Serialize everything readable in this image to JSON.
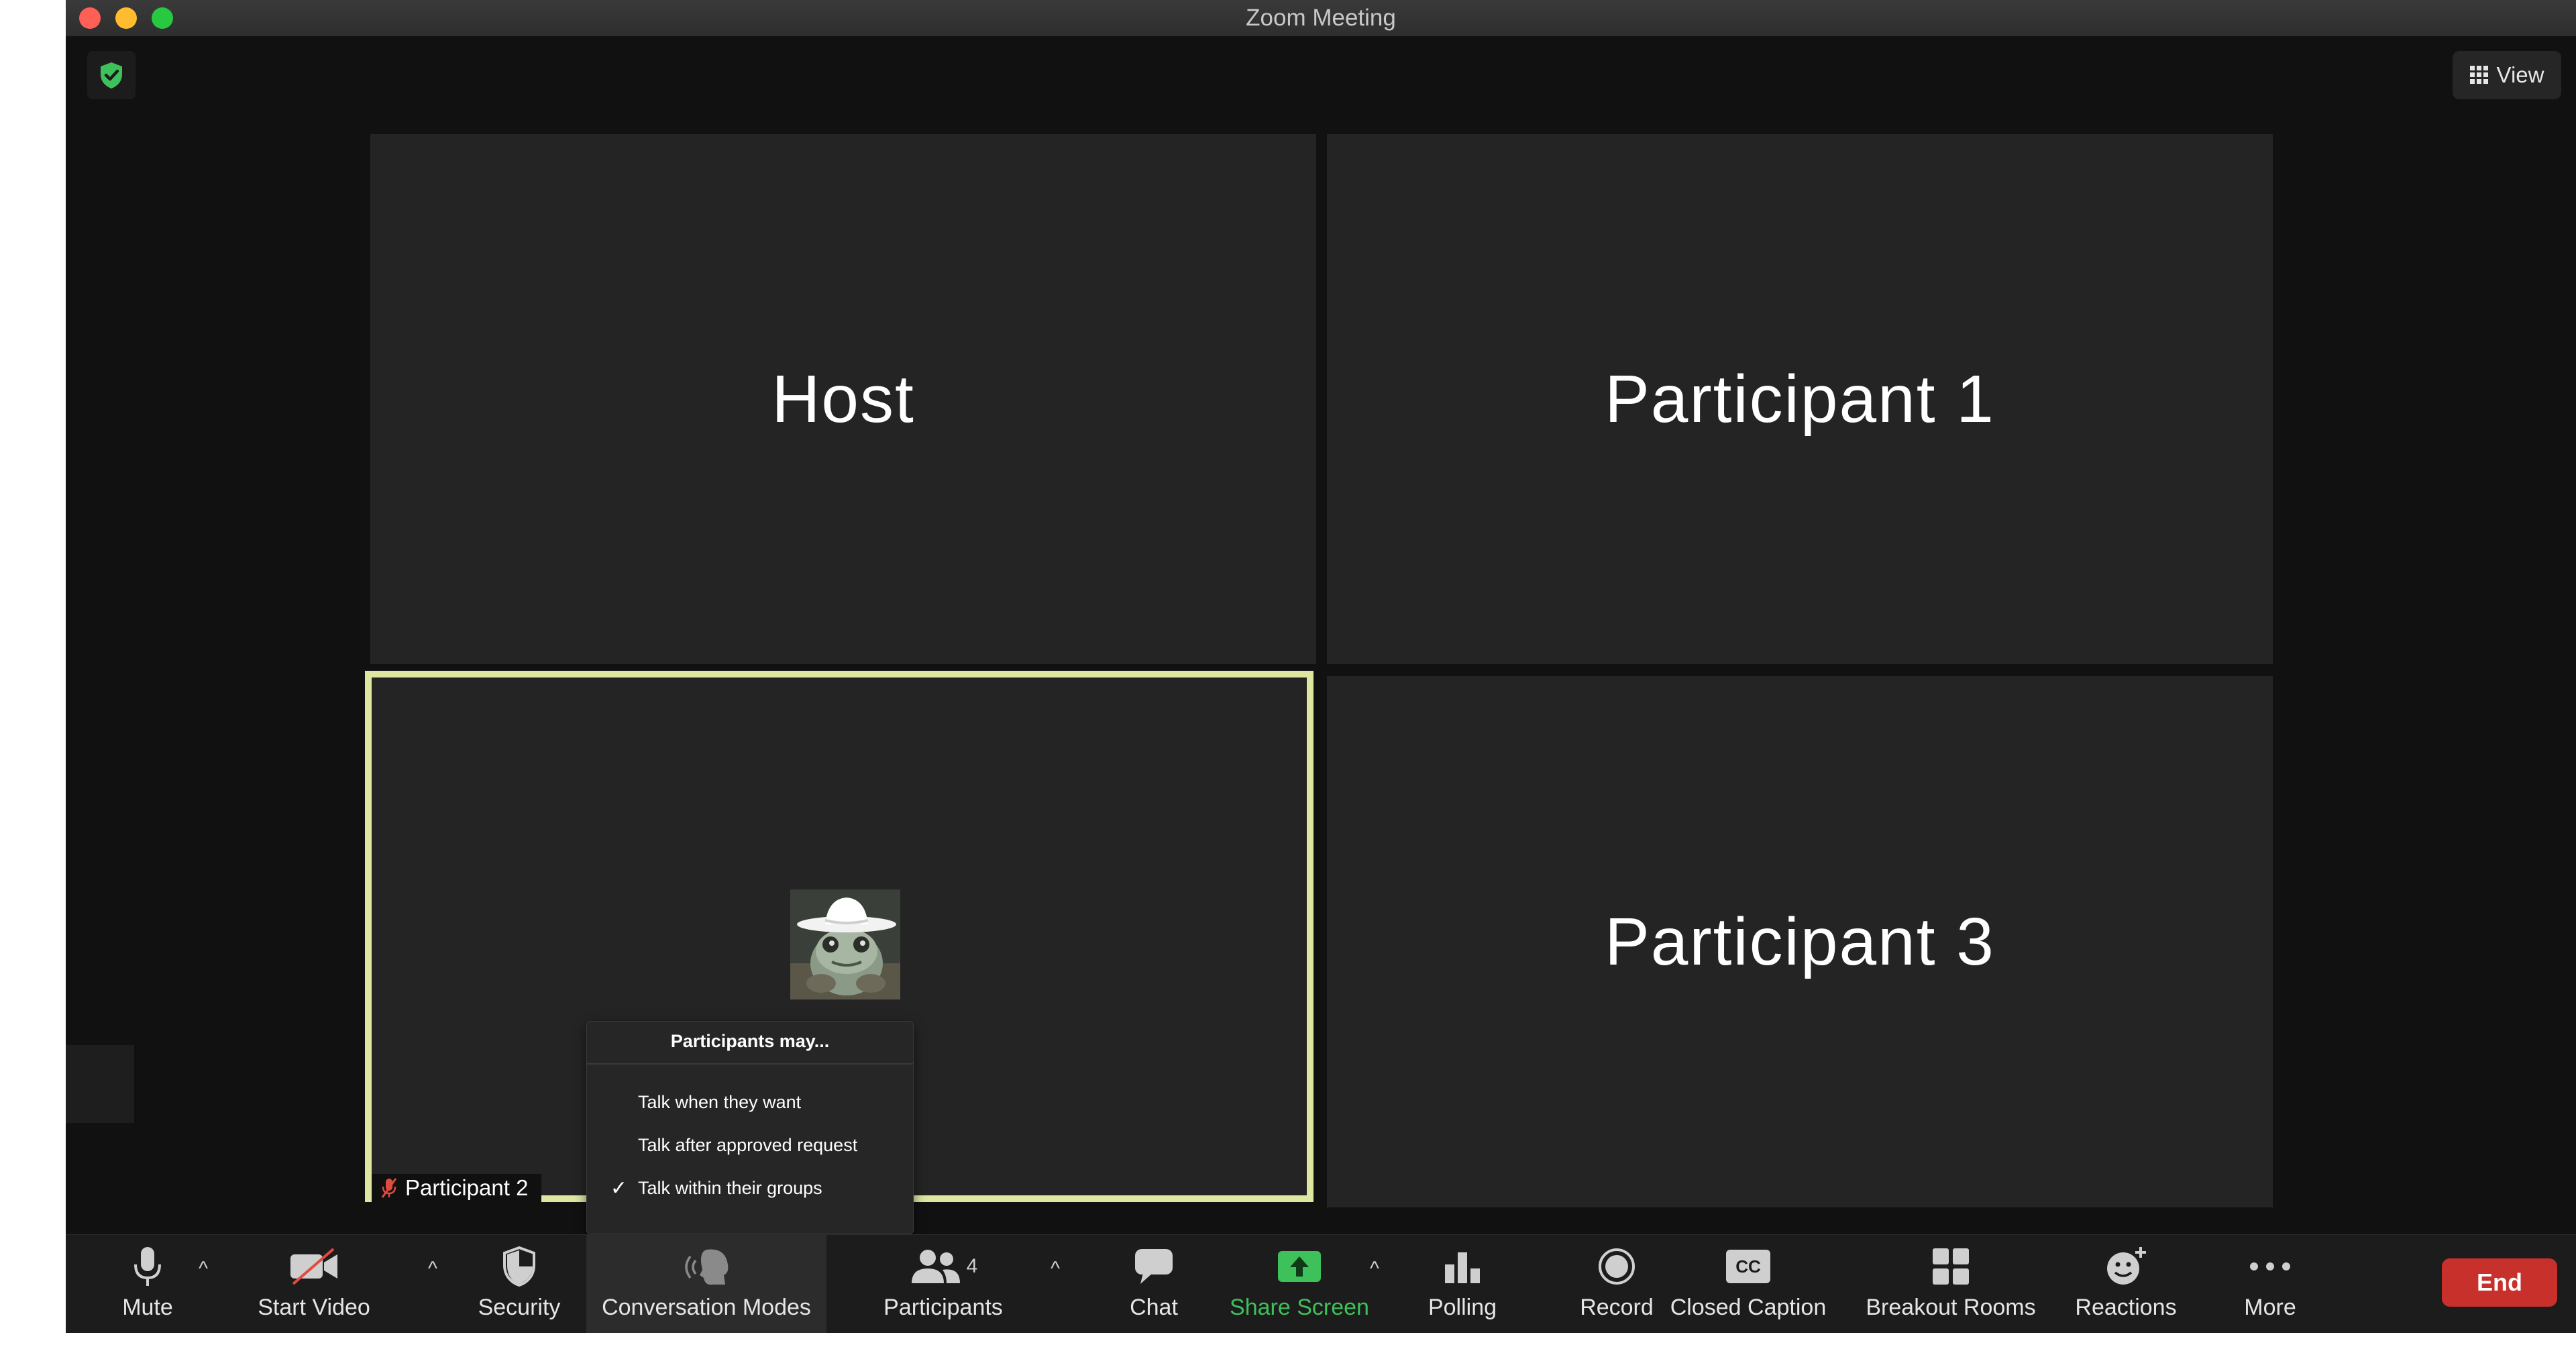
{
  "window": {
    "title": "Zoom Meeting"
  },
  "top_bar": {
    "view_label": "View"
  },
  "tiles": {
    "host": "Host",
    "p1": "Participant 1",
    "p2": "Participant 2",
    "p3": "Participant 3"
  },
  "conversation_menu": {
    "title": "Participants may...",
    "items": [
      {
        "label": "Talk when they want",
        "checked": false
      },
      {
        "label": "Talk after approved request",
        "checked": false
      },
      {
        "label": "Talk within their groups",
        "checked": true
      }
    ],
    "check_mark": "✓"
  },
  "toolbar": {
    "mute": "Mute",
    "start_video": "Start Video",
    "security": "Security",
    "conversation_modes": "Conversation Modes",
    "participants": "Participants",
    "participants_count": "4",
    "chat": "Chat",
    "share_screen": "Share Screen",
    "polling": "Polling",
    "record": "Record",
    "closed_caption": "Closed Caption",
    "cc_badge": "CC",
    "breakout_rooms": "Breakout Rooms",
    "reactions": "Reactions",
    "more": "More",
    "end": "End"
  },
  "colors": {
    "active_speaker_border": "#dfe6a2",
    "share_green": "#3ec15a",
    "end_red": "#c7302b",
    "shield_green": "#3ec15a"
  },
  "icons": {
    "security_badge": "shield-check-icon",
    "view": "grid-icon",
    "mute": "microphone-icon",
    "video": "video-off-icon",
    "security": "shield-icon",
    "conversation": "speaking-head-icon",
    "participants": "people-icon",
    "chat": "chat-bubble-icon",
    "share": "share-screen-icon",
    "polling": "bar-chart-icon",
    "record": "record-icon",
    "cc": "cc-icon",
    "breakout": "breakout-grid-icon",
    "reactions": "smiley-plus-icon",
    "more": "ellipsis-icon"
  }
}
